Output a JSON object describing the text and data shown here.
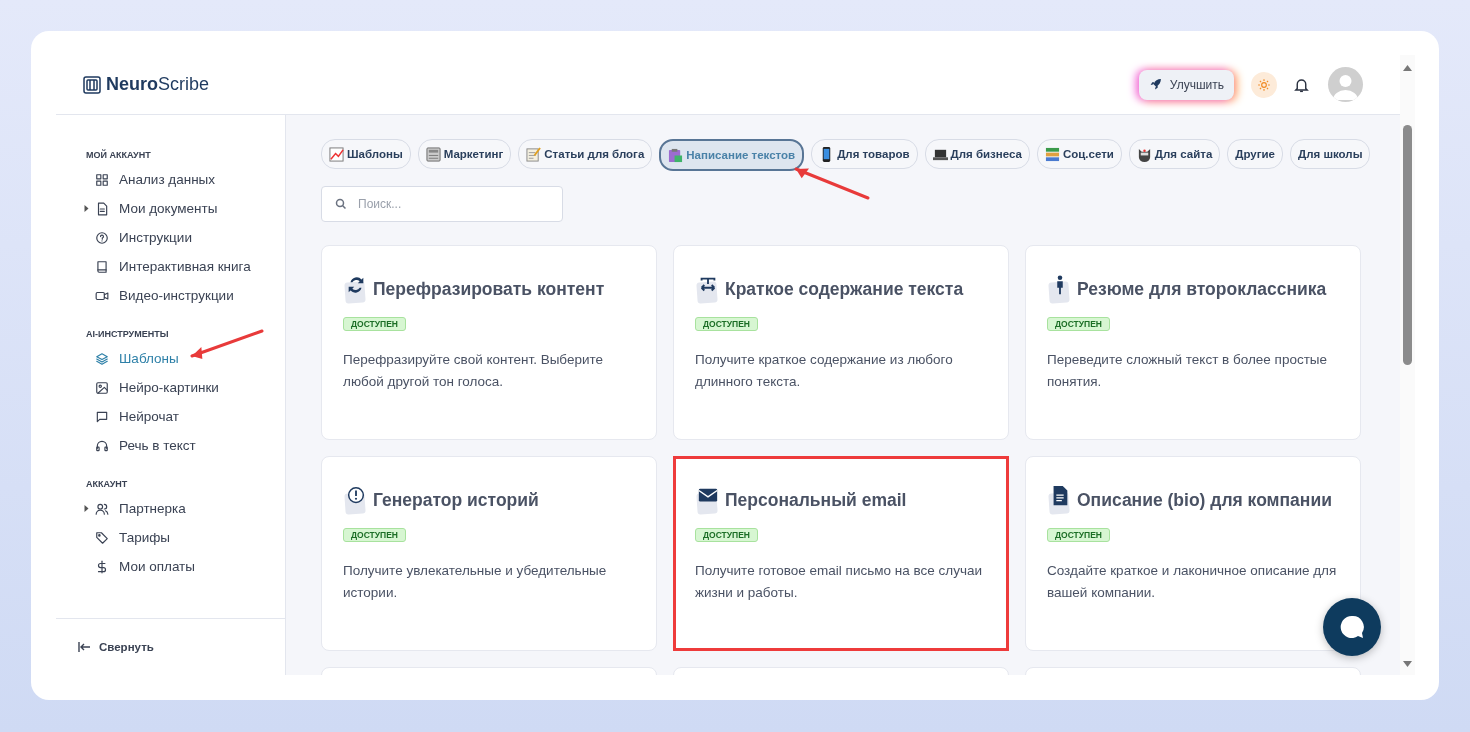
{
  "header": {
    "logo": "**Neuro**Scribe",
    "upgrade_button": "Улучшить"
  },
  "sidebar": {
    "sections": [
      {
        "heading": "МОЙ АККАУНТ",
        "items": [
          {
            "label": "Анализ данных",
            "kind": "link",
            "selected": false,
            "annotated": false
          },
          {
            "label": "Мои документы",
            "kind": "group",
            "selected": false,
            "annotated": false
          },
          {
            "label": "Инструкции",
            "kind": "link",
            "selected": false,
            "annotated": false
          },
          {
            "label": "Интерактивная книга",
            "kind": "link",
            "selected": false,
            "annotated": false
          },
          {
            "label": "Видео-инструкции",
            "kind": "link",
            "selected": false,
            "annotated": false
          }
        ]
      },
      {
        "heading": "AI-ИНСТРУМЕНТЫ",
        "items": [
          {
            "label": "Шаблоны",
            "kind": "link",
            "selected": true,
            "annotated": true
          },
          {
            "label": "Нейро-картинки",
            "kind": "link",
            "selected": false,
            "annotated": false
          },
          {
            "label": "Нейрочат",
            "kind": "link",
            "selected": false,
            "annotated": false
          },
          {
            "label": "Речь в текст",
            "kind": "link",
            "selected": false,
            "annotated": false
          }
        ]
      },
      {
        "heading": "АККАУНТ",
        "items": [
          {
            "label": "Партнерка",
            "kind": "group",
            "selected": false,
            "annotated": false
          },
          {
            "label": "Тарифы",
            "kind": "link",
            "selected": false,
            "annotated": false
          },
          {
            "label": "Мои оплаты",
            "kind": "link",
            "selected": false,
            "annotated": false
          }
        ]
      }
    ],
    "collapse": "Свернуть"
  },
  "chips": [
    {
      "label": "Шаблоны",
      "selected": false,
      "annotated": false
    },
    {
      "label": "Маркетинг",
      "selected": false,
      "annotated": false
    },
    {
      "label": "Статьи для блога",
      "selected": false,
      "annotated": false
    },
    {
      "label": "Написание текстов",
      "selected": true,
      "annotated": true
    },
    {
      "label": "Для товаров",
      "selected": false,
      "annotated": false
    },
    {
      "label": "Для бизнеса",
      "selected": false,
      "annotated": false
    },
    {
      "label": "Соц.сети",
      "selected": false,
      "annotated": false
    },
    {
      "label": "Для сайта",
      "selected": false,
      "annotated": false
    },
    {
      "label": "Другие",
      "selected": false,
      "annotated": false
    },
    {
      "label": "Для школы",
      "selected": false,
      "annotated": false
    }
  ],
  "search": {
    "placeholder": "Поиск..."
  },
  "cards": [
    {
      "title": "Перефразировать контент",
      "badge": "ДОСТУПЕН",
      "description": "Перефразируйте свой контент. Выберите любой другой тон голоса.",
      "highlighted": false
    },
    {
      "title": "Краткое содержание текста",
      "badge": "ДОСТУПЕН",
      "description": "Получите краткое содержание из любого длинного текста.",
      "highlighted": false
    },
    {
      "title": "Резюме для второклассника",
      "badge": "ДОСТУПЕН",
      "description": "Переведите сложный текст в более простые понятия.",
      "highlighted": false
    },
    {
      "title": "Генератор историй",
      "badge": "ДОСТУПЕН",
      "description": "Получите увлекательные и убедительные истории.",
      "highlighted": false
    },
    {
      "title": "Персональный email",
      "badge": "ДОСТУПЕН",
      "description": "Получите готовое email письмо на все случаи жизни и работы.",
      "highlighted": true
    },
    {
      "title": "Описание (bio) для компании",
      "badge": "ДОСТУПЕН",
      "description": "Создайте краткое и лаконичное описание для вашей компании.",
      "highlighted": false
    }
  ]
}
